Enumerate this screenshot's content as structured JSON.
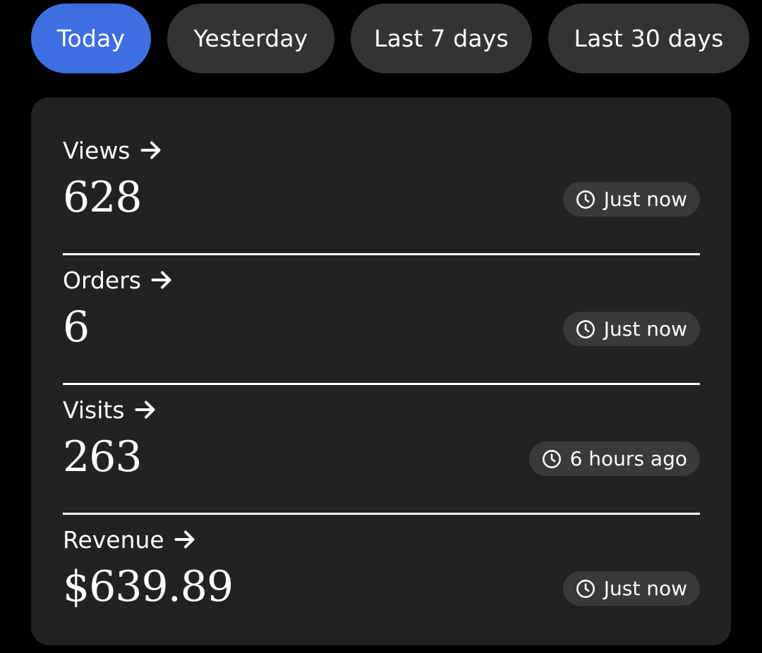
{
  "tabs": [
    {
      "label": "Today",
      "active": true
    },
    {
      "label": "Yesterday",
      "active": false
    },
    {
      "label": "Last 7 days",
      "active": false
    },
    {
      "label": "Last 30 days",
      "active": false
    }
  ],
  "metrics": [
    {
      "label": "Views",
      "value": "628",
      "updated": "Just now",
      "icon": "arrow-right-icon"
    },
    {
      "label": "Orders",
      "value": "6",
      "updated": "Just now",
      "icon": "arrow-right-icon"
    },
    {
      "label": "Visits",
      "value": "263",
      "updated": "6 hours ago",
      "icon": "arrow-right-icon"
    },
    {
      "label": "Revenue",
      "value": "$639.89",
      "updated": "Just now",
      "icon": "arrow-right-icon"
    }
  ],
  "colors": {
    "background": "#000000",
    "card": "#222222",
    "tab": "#333333",
    "tab_active": "#3f6ee0",
    "badge": "#3a3a3a",
    "text": "#ffffff"
  }
}
